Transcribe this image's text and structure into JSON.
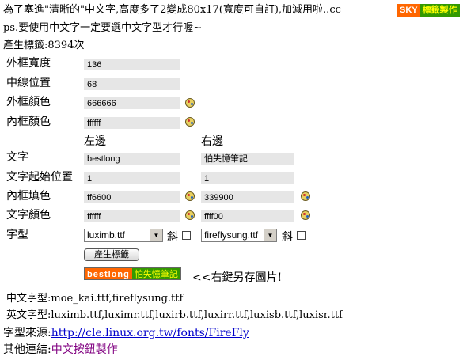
{
  "intro": {
    "line1": "為了塞進\"清晰的\"中文字,高度多了2變成80x17(寬度可自訂),加減用啦..cc",
    "line2": "ps.要使用中文字一定要選中文字型才行喔~",
    "counter": "產生標籤:8394次",
    "badge_left": "SKY",
    "badge_right": "標籤製作"
  },
  "form": {
    "outer_width_label": "外框寬度",
    "outer_width_value": "136",
    "mid_line_label": "中線位置",
    "mid_line_value": "68",
    "outer_color_label": "外框顏色",
    "outer_color_value": "666666",
    "inner_color_label": "內框顏色",
    "inner_color_value": "ffffff",
    "left_header": "左邊",
    "right_header": "右邊",
    "text_label": "文字",
    "text_left": "bestlong",
    "text_right": "怕失憶筆記",
    "start_label": "文字起始位置",
    "start_left": "1",
    "start_right": "1",
    "fill_label": "內框填色",
    "fill_left": "ff6600",
    "fill_right": "339900",
    "text_color_label": "文字顏色",
    "text_color_left": "ffffff",
    "text_color_right": "ffff00",
    "font_label": "字型",
    "font_left": "luximb.ttf",
    "font_right": "fireflysung.ttf",
    "italic_label": "斜",
    "generate_button": "產生標籤"
  },
  "preview": {
    "left_text": "bestlong",
    "right_text": "怕失憶筆記",
    "left_color": "#ff6600",
    "right_color": "#339900",
    "right_text_color": "#ffff00",
    "hint": "<<右鍵另存圖片!"
  },
  "fonts_info": {
    "chinese": "中文字型:moe_kai.ttf,fireflysung.ttf",
    "english": "英文字型:luximb.ttf,luximr.ttf,luxirb.ttf,luxirr.ttf,luxisb.ttf,luxisr.ttf",
    "source_label": "字型來源:",
    "source_link": "http://cle.linux.org.tw/fonts/FireFly",
    "other_label": "其他連結:",
    "other_link": "中文按鈕製作"
  }
}
